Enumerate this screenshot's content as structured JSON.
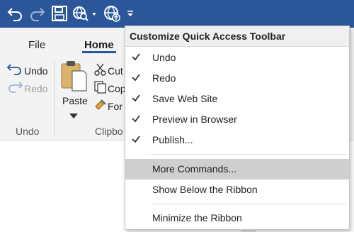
{
  "colors": {
    "title_bar": "#2b579a",
    "ribbon_bg": "#f3f3f3",
    "menu_hover": "#cfcfcf",
    "accent_blue": "#2b579a"
  },
  "quick_access": {
    "icons": [
      "undo-icon",
      "redo-icon",
      "save-icon",
      "preview-in-browser-icon",
      "publish-icon",
      "customize-dropdown-icon"
    ]
  },
  "tabs": [
    {
      "label": "File"
    },
    {
      "label": "Home"
    }
  ],
  "ribbon": {
    "undo_label": "Undo",
    "redo_label": "Redo",
    "paste_label": "Paste",
    "cut_label": "Cut",
    "copy_label": "Cop",
    "format_label": "For",
    "group_undo": "Undo",
    "group_clipboard": "Clipbo"
  },
  "menu": {
    "title": "Customize Quick Access Toolbar",
    "items": [
      {
        "label": "Undo",
        "checked": true
      },
      {
        "label": "Redo",
        "checked": true
      },
      {
        "label": "Save Web Site",
        "checked": true
      },
      {
        "label": "Preview in Browser",
        "checked": true
      },
      {
        "label": "Publish...",
        "checked": true
      },
      {
        "label": "More Commands...",
        "checked": false,
        "highlighted": true
      },
      {
        "label": "Show Below the Ribbon",
        "checked": false
      },
      {
        "label": "Minimize the Ribbon",
        "checked": false
      }
    ]
  }
}
